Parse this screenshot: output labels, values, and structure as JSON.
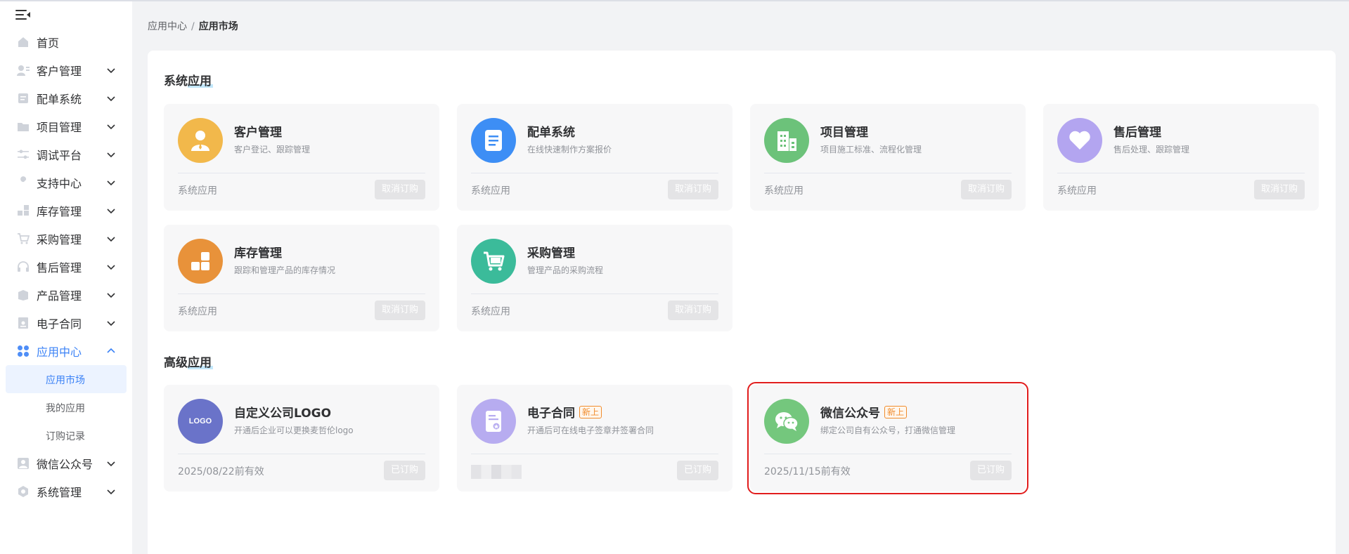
{
  "sidebar": {
    "items": [
      {
        "label": "首页",
        "icon": "home-icon",
        "has_children": false
      },
      {
        "label": "客户管理",
        "icon": "customer-icon",
        "has_children": true
      },
      {
        "label": "配单系统",
        "icon": "order-icon",
        "has_children": true
      },
      {
        "label": "项目管理",
        "icon": "folder-icon",
        "has_children": true
      },
      {
        "label": "调试平台",
        "icon": "sliders-icon",
        "has_children": true
      },
      {
        "label": "支持中心",
        "icon": "wrench-icon",
        "has_children": true
      },
      {
        "label": "库存管理",
        "icon": "inventory-icon",
        "has_children": true
      },
      {
        "label": "采购管理",
        "icon": "cart-icon",
        "has_children": true
      },
      {
        "label": "售后管理",
        "icon": "headset-icon",
        "has_children": true
      },
      {
        "label": "产品管理",
        "icon": "box-icon",
        "has_children": true
      },
      {
        "label": "电子合同",
        "icon": "contract-icon",
        "has_children": true
      },
      {
        "label": "应用中心",
        "icon": "apps-icon",
        "has_children": true,
        "expanded": true
      },
      {
        "label": "微信公众号",
        "icon": "wechat-user-icon",
        "has_children": true
      },
      {
        "label": "系统管理",
        "icon": "settings-icon",
        "has_children": true
      }
    ],
    "app_center_children": [
      {
        "label": "应用市场",
        "active": true
      },
      {
        "label": "我的应用",
        "active": false
      },
      {
        "label": "订购记录",
        "active": false
      }
    ]
  },
  "breadcrumb": {
    "parent": "应用中心",
    "separator": "/",
    "current": "应用市场"
  },
  "system_apps": {
    "title_a": "系统",
    "title_b": "应用",
    "cards": [
      {
        "title": "客户管理",
        "desc": "客户登记、跟踪管理",
        "footer": "系统应用",
        "button": "取消订购",
        "icon": "person-icon",
        "color": "#f2b84b"
      },
      {
        "title": "配单系统",
        "desc": "在线快速制作方案报价",
        "footer": "系统应用",
        "button": "取消订购",
        "icon": "document-icon",
        "color": "#3d8ef5"
      },
      {
        "title": "项目管理",
        "desc": "项目施工标准、流程化管理",
        "footer": "系统应用",
        "button": "取消订购",
        "icon": "building-icon",
        "color": "#6cc27a"
      },
      {
        "title": "售后管理",
        "desc": "售后处理、跟踪管理",
        "footer": "系统应用",
        "button": "取消订购",
        "icon": "heart-icon",
        "color": "#b3a5f0"
      },
      {
        "title": "库存管理",
        "desc": "跟踪和管理产品的库存情况",
        "footer": "系统应用",
        "button": "取消订购",
        "icon": "blocks-icon",
        "color": "#e8923a"
      },
      {
        "title": "采购管理",
        "desc": "管理产品的采购流程",
        "footer": "系统应用",
        "button": "取消订购",
        "icon": "cart-icon",
        "color": "#3bbb9a"
      }
    ]
  },
  "advanced_apps": {
    "title_a": "高级",
    "title_b": "应用",
    "cards": [
      {
        "title": "自定义公司LOGO",
        "badge": "",
        "desc": "开通后企业可以更换麦哲伦logo",
        "footer": "2025/08/22前有效",
        "button": "已订购",
        "icon": "logo-icon",
        "icon_text": "LOGO",
        "color": "#6a73c9"
      },
      {
        "title": "电子合同",
        "badge": "新上",
        "desc": "开通后可在线电子签章并签署合同",
        "footer": "",
        "button": "已订购",
        "icon": "contract-icon",
        "color": "#b7acf0"
      },
      {
        "title": "微信公众号",
        "badge": "新上",
        "desc": "绑定公司自有公众号，打通微信管理",
        "footer": "2025/11/15前有效",
        "button": "已订购",
        "icon": "wechat-icon",
        "color": "#74c77d"
      }
    ]
  }
}
